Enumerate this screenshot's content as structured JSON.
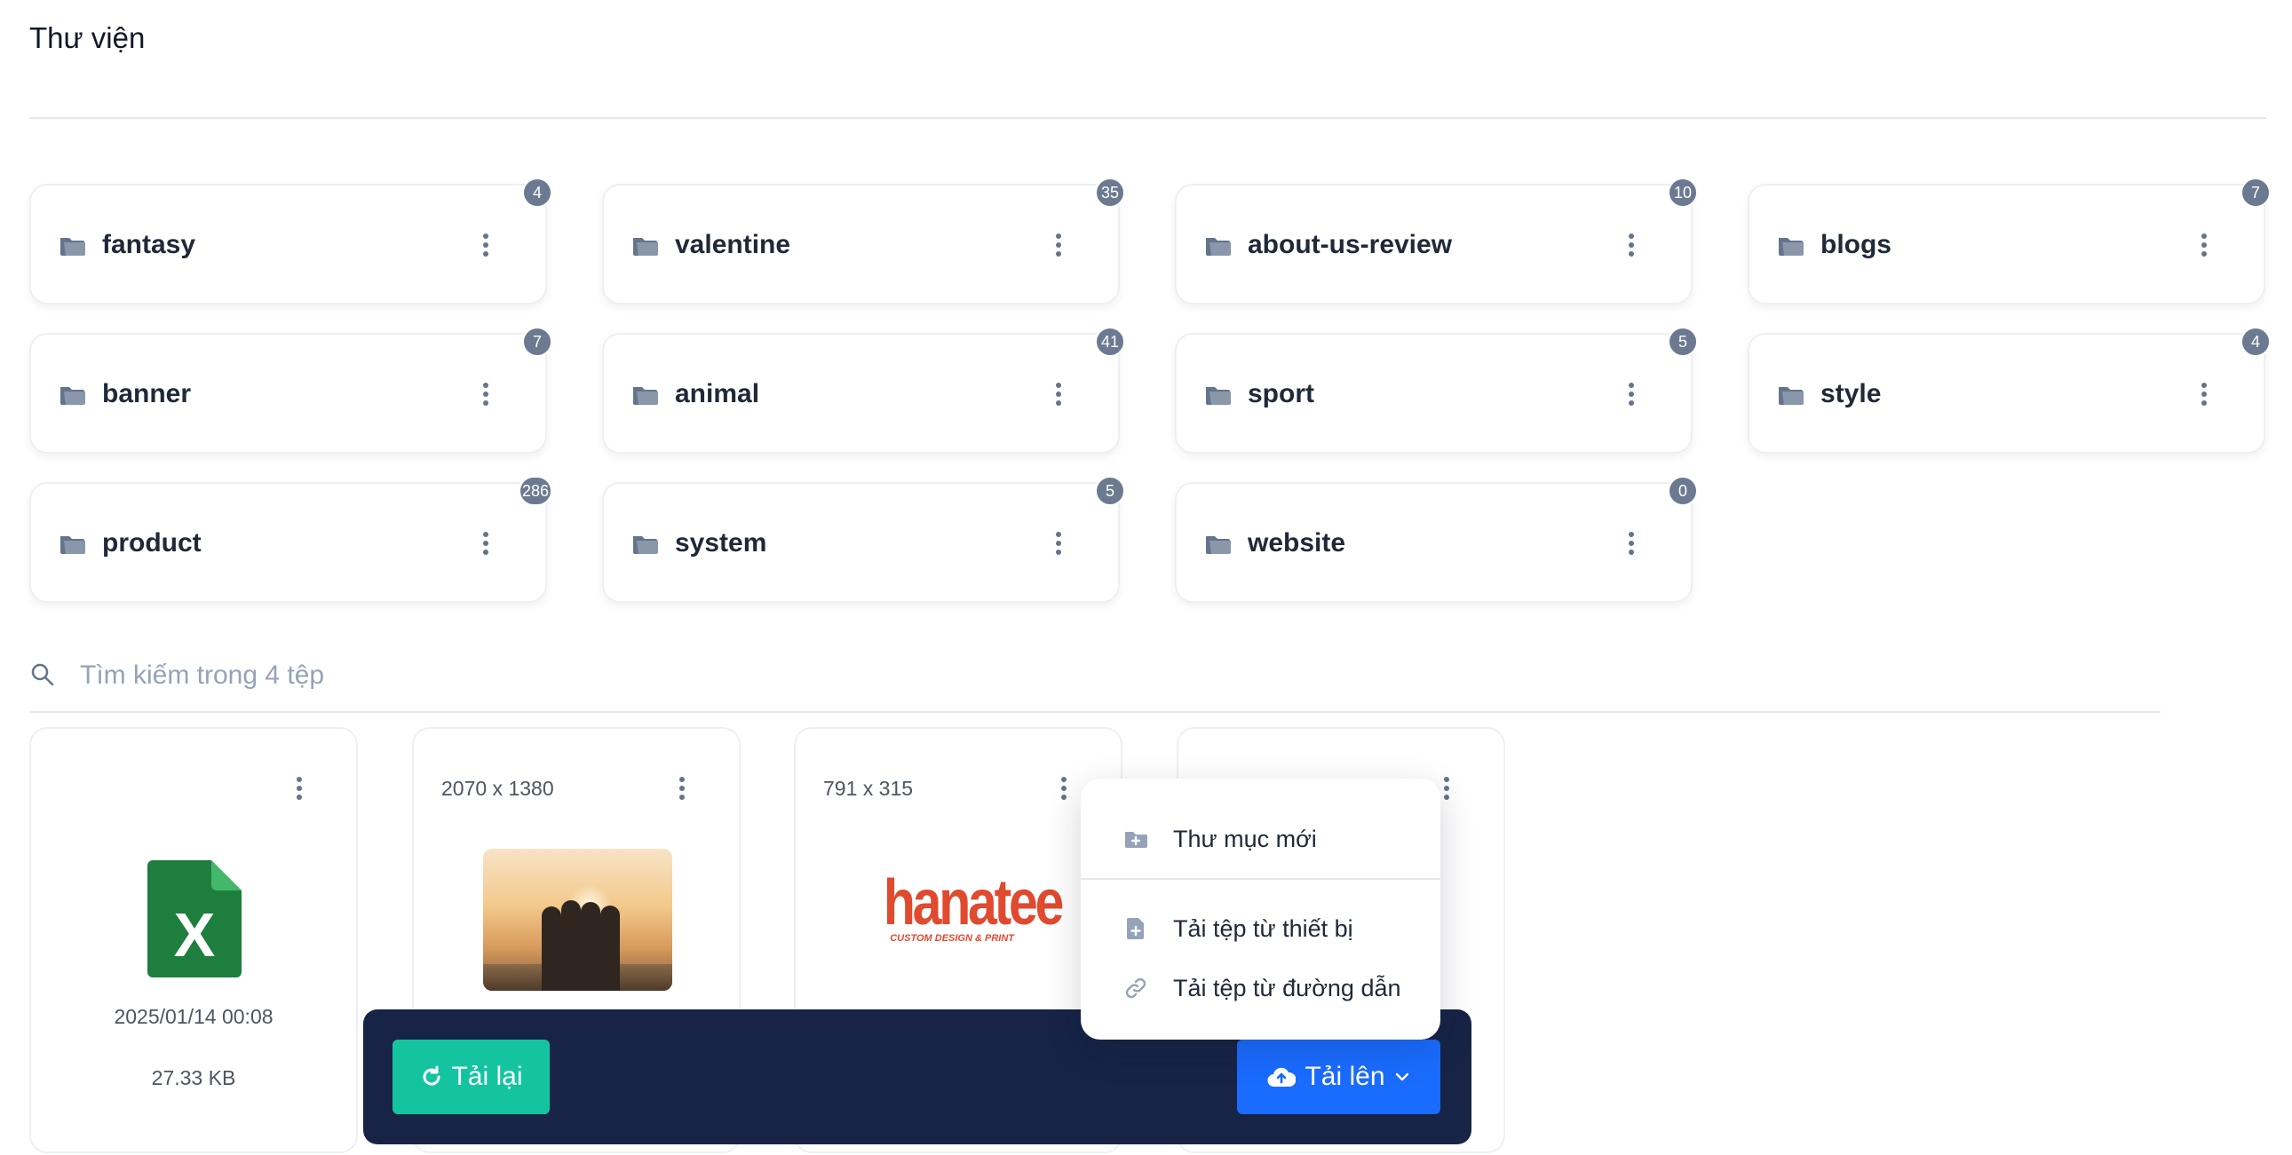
{
  "page": {
    "title": "Thư viện"
  },
  "folders": [
    {
      "name": "fantasy",
      "count": "4"
    },
    {
      "name": "valentine",
      "count": "35"
    },
    {
      "name": "about-us-review",
      "count": "10"
    },
    {
      "name": "blogs",
      "count": "7"
    },
    {
      "name": "banner",
      "count": "7"
    },
    {
      "name": "animal",
      "count": "41"
    },
    {
      "name": "sport",
      "count": "5"
    },
    {
      "name": "style",
      "count": "4"
    },
    {
      "name": "product",
      "count": "286"
    },
    {
      "name": "system",
      "count": "5"
    },
    {
      "name": "website",
      "count": "0"
    }
  ],
  "search": {
    "placeholder": "Tìm kiếm trong 4 tệp"
  },
  "files": [
    {
      "dims": "",
      "date": "2025/01/14 00:08",
      "size": "27.33 KB",
      "kind": "excel-icon"
    },
    {
      "dims": "2070 x 1380",
      "kind": "photo"
    },
    {
      "dims": "791 x 315",
      "kind": "logo",
      "logo_text": "hanatee",
      "logo_sub": "CUSTOM DESIGN & PRINT"
    },
    {
      "dims": "",
      "kind": "hidden"
    }
  ],
  "toolbar": {
    "reload_label": "Tải lại",
    "upload_label": "Tải lên"
  },
  "dropdown": {
    "new_folder": "Thư mục mới",
    "upload_device": "Tải tệp từ thiết bị",
    "upload_url": "Tải tệp từ đường dẫn"
  },
  "colors": {
    "accent_green": "#14c4a0",
    "accent_blue": "#1a6cff",
    "toolbar_bg": "#172446",
    "badge": "#6b7a90"
  }
}
